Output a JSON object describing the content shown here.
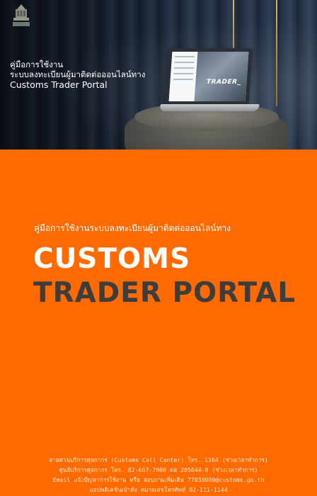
{
  "hero": {
    "caption_line1": "คู่มือการใช้งาน",
    "caption_line2": "ระบบลงทะเบียนผู้มาติดต่อออนไลน์ทาง",
    "caption_line3": "Customs Trader Portal",
    "laptop_screen_word": "TRADER_"
  },
  "cover": {
    "subtitle": "คู่มือการใช้งานระบบลงทะเบียนผู้มาติดต่อออนไลน์ทาง",
    "title_line1": "CUSTOMS",
    "title_line2": "TRADER PORTAL",
    "background_color": "#ff6b00",
    "title2_color": "#3d3d3d"
  },
  "footer": {
    "line1": "สายด่วนบริการศุลกากร (Customs Call Center) โทร. 1164 (ช่วงเวลาทำการ)",
    "line2": "ศูนย์บริการศุลกากร โทร. 02-667-7000 ต่อ 205844-8 (ช่วงเวลาทำการ)",
    "line3": "Email แจ้งปัญหาการใช้งาน หรือ สอบถามเพิ่มเติม 77030000@customs.go.th",
    "line4": "แอปพลิเคชันเป๋าตัง หมายเลขโทรศัพท์ 02-111-1144"
  }
}
